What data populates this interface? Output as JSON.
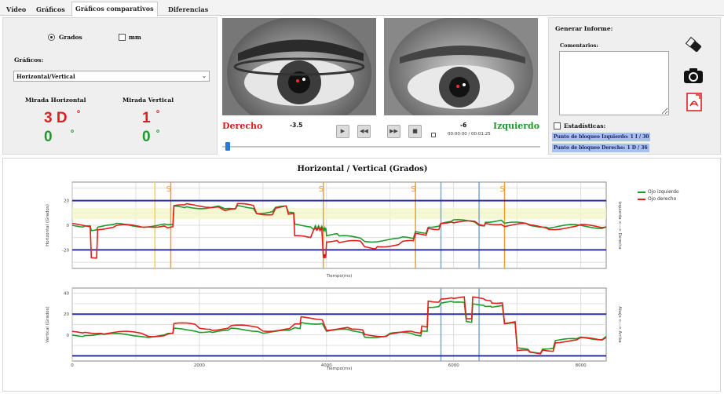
{
  "tabs": [
    {
      "label": "Vídeo"
    },
    {
      "label": "Gráficos"
    },
    {
      "label": "Gráficos comparativos",
      "active": true
    },
    {
      "label": "Diferencias"
    }
  ],
  "units": {
    "grados_label": "Grados",
    "mm_label": "mm",
    "selected": "Grados"
  },
  "graficos": {
    "label": "Gráficos:",
    "selected": "Horizontal/Vertical"
  },
  "mirada": {
    "horizontal_label": "Mirada Horizontal",
    "vertical_label": "Mirada Vertical",
    "h_derecho": "3 D",
    "h_izquierdo": "0",
    "v_derecho": "1",
    "v_izquierdo": "0",
    "degree_mark": "º"
  },
  "player": {
    "derecho_label": "Derecho",
    "izquierdo_label": "Izquierdo",
    "derecho_value": "-3.5",
    "izquierdo_value": "-6",
    "time": "00:00:00 / 00:01:25",
    "progress": 0.01
  },
  "informe": {
    "title": "Generar Informe:",
    "comentarios_label": "Comentarios:",
    "estadisticas_label": "Estadísticas:",
    "bloqueo_izq": "Punto de bloqueo Izquierdo: 1 I / 30",
    "bloqueo_der": "Punto de bloqueo Derecho: 1 D / 36"
  },
  "colors": {
    "izquierdo": "#1f9b2c",
    "derecho": "#e0201b",
    "limit": "#2b2fa0",
    "marker_yellow": "#f2d72e",
    "marker_orange": "#f0a030",
    "marker_blue": "#7aa6d8"
  },
  "chart_data": [
    {
      "type": "line",
      "title": "Horizontal / Vertical (Grados)",
      "ylabel": "Horizontal (Grados)",
      "xlabel": "Tiempo(ms)",
      "right_label": "Izquierda  <--->  Derecha",
      "ylim": [
        -35,
        35
      ],
      "yticks": [
        -20,
        0,
        20
      ],
      "limits": [
        20,
        -20
      ],
      "legend": [
        "Ojo izquierdo",
        "Ojo derecho"
      ],
      "markers": [
        {
          "x": 1300,
          "color": "yellow",
          "label": ""
        },
        {
          "x": 1550,
          "color": "orange",
          "label": "S"
        },
        {
          "x": 3950,
          "color": "orange",
          "label": "S"
        },
        {
          "x": 5400,
          "color": "orange",
          "label": "S"
        },
        {
          "x": 5800,
          "color": "blue",
          "label": ""
        },
        {
          "x": 6400,
          "color": "blue",
          "label": ""
        },
        {
          "x": 6800,
          "color": "orange",
          "label": "S"
        }
      ],
      "series": [
        {
          "name": "Ojo izquierdo",
          "x": [
            0,
            200,
            300,
            400,
            700,
            1200,
            1500,
            1600,
            1800,
            2400,
            2600,
            2900,
            3200,
            3400,
            3500,
            3800,
            3950,
            4000,
            4200,
            4600,
            4800,
            5200,
            5400,
            5600,
            5800,
            6000,
            6400,
            6500,
            6800,
            7200,
            7500,
            8000,
            8400
          ],
          "y": [
            0,
            1,
            -3,
            -1,
            0,
            0,
            -1,
            14,
            15,
            12,
            15,
            11,
            14,
            9,
            0,
            -2,
            -3,
            -8,
            -10,
            -12,
            -12,
            -11,
            -5,
            0,
            2,
            3,
            1,
            4,
            1,
            0,
            -1,
            -1,
            0
          ]
        },
        {
          "name": "Ojo derecho",
          "x": [
            0,
            200,
            300,
            400,
            700,
            1200,
            1500,
            1600,
            1800,
            2400,
            2600,
            2900,
            3200,
            3400,
            3500,
            3800,
            3950,
            4000,
            4200,
            4600,
            4800,
            5200,
            5400,
            5600,
            5800,
            6000,
            6400,
            6500,
            6800,
            7200,
            7500,
            8000,
            8400
          ],
          "y": [
            0,
            0,
            -25,
            -2,
            -1,
            0,
            -2,
            15,
            16,
            12,
            16,
            10,
            15,
            8,
            -10,
            -3,
            -25,
            -12,
            -14,
            -18,
            -16,
            -14,
            -8,
            -2,
            3,
            2,
            0,
            2,
            0,
            -1,
            -2,
            -1,
            0
          ]
        }
      ]
    },
    {
      "type": "line",
      "ylabel": "Vertical (Grados)",
      "xlabel": "Tiempo(ms)",
      "right_label": "Abajo  <--->  Arriba",
      "ylim": [
        -25,
        45
      ],
      "yticks": [
        0,
        20,
        40
      ],
      "xlim": [
        0,
        8400
      ],
      "xticks": [
        0,
        2000,
        4000,
        6000,
        8000
      ],
      "limits": [
        20,
        -20
      ],
      "markers": [
        {
          "x": 5800,
          "color": "blue",
          "label": ""
        },
        {
          "x": 6400,
          "color": "blue",
          "label": ""
        }
      ],
      "series": [
        {
          "name": "Ojo izquierdo",
          "x": [
            0,
            200,
            500,
            1200,
            1500,
            1600,
            2000,
            2200,
            2500,
            3000,
            3500,
            3600,
            4000,
            4400,
            4600,
            5000,
            5400,
            5500,
            5600,
            5800,
            6000,
            6200,
            6300,
            6500,
            6600,
            6800,
            7000,
            7200,
            7400,
            7600,
            8000,
            8400
          ],
          "y": [
            0,
            1,
            0,
            -1,
            0,
            5,
            4,
            3,
            5,
            3,
            6,
            12,
            4,
            3,
            -1,
            1,
            0,
            5,
            28,
            31,
            30,
            12,
            30,
            29,
            28,
            10,
            -14,
            -16,
            -12,
            -5,
            -3,
            0
          ]
        },
        {
          "name": "Ojo derecho",
          "x": [
            0,
            200,
            500,
            1200,
            1500,
            1600,
            2000,
            2200,
            2500,
            3000,
            3500,
            3600,
            4000,
            4400,
            4600,
            5000,
            5400,
            5500,
            5600,
            5800,
            6000,
            6200,
            6300,
            6500,
            6600,
            6800,
            7000,
            7200,
            7400,
            7600,
            8000,
            8400
          ],
          "y": [
            2,
            3,
            2,
            0,
            1,
            10,
            7,
            6,
            8,
            5,
            9,
            16,
            6,
            4,
            0,
            2,
            1,
            8,
            33,
            36,
            35,
            14,
            35,
            34,
            32,
            12,
            -16,
            -18,
            -14,
            -6,
            -4,
            -1
          ]
        }
      ]
    }
  ]
}
